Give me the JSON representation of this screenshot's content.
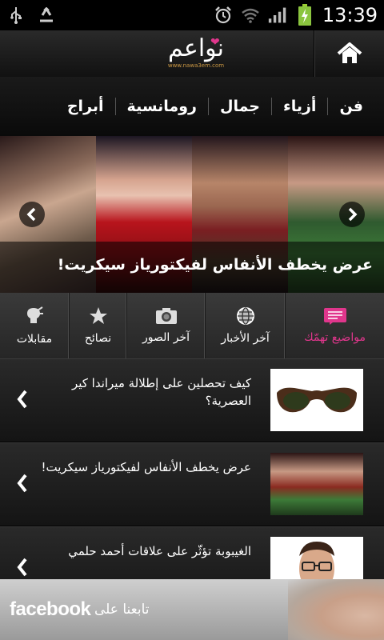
{
  "status_bar": {
    "time": "13:39",
    "left_icons": [
      "usb-icon",
      "recycle-icon"
    ],
    "right_icons": [
      "alarm-icon",
      "wifi-icon",
      "signal-icon",
      "battery-charging-icon"
    ]
  },
  "header": {
    "logo_text": "نواعم",
    "logo_site": "www.nawa3em.com",
    "home_icon": "home-icon"
  },
  "categories": [
    "فن",
    "أزياء",
    "جمال",
    "رومانسية",
    "أبراج"
  ],
  "slider": {
    "caption": "عرض يخطف الأنفاس لفيكتورياز سيكريت!"
  },
  "tabs": [
    {
      "label": "مواضيع تهمّك",
      "icon": "topics-icon",
      "active": true
    },
    {
      "label": "آخر الأخبار",
      "icon": "globe-icon",
      "active": false
    },
    {
      "label": "آخر الصور",
      "icon": "camera-icon",
      "active": false
    },
    {
      "label": "نصائح",
      "icon": "star-icon",
      "active": false
    },
    {
      "label": "مقابلات",
      "icon": "interview-icon",
      "active": false
    }
  ],
  "articles": [
    {
      "title": "كيف تحصلين على إطلالة ميراندا كير العصرية؟",
      "thumb": "sunglasses"
    },
    {
      "title": "عرض يخطف الأنفاس لفيكتورياز سيكريت!",
      "thumb": "runway"
    },
    {
      "title": "الغيبوبة تؤثّر على علاقات أحمد حلمي",
      "thumb": "man"
    }
  ],
  "facebook": {
    "brand": "facebook",
    "follow_text": "تابعنا على"
  },
  "colors": {
    "accent": "#e0368c",
    "background": "#1b1b1b"
  }
}
